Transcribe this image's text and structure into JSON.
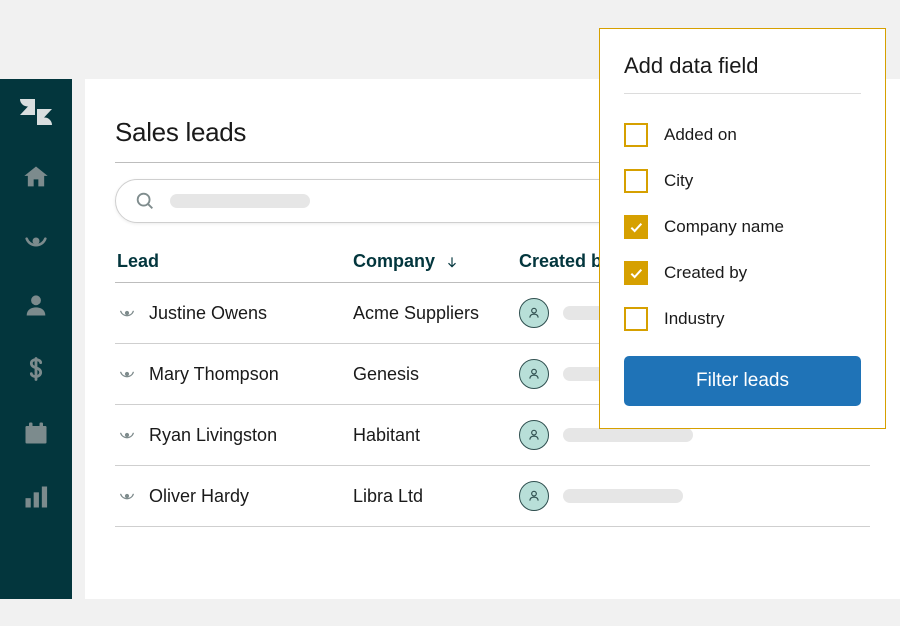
{
  "page": {
    "title": "Sales leads"
  },
  "columns": {
    "lead": "Lead",
    "company": "Company",
    "created": "Created by"
  },
  "rows": [
    {
      "lead": "Justine Owens",
      "company": "Acme Suppliers",
      "ph_width": 60
    },
    {
      "lead": "Mary Thompson",
      "company": "Genesis",
      "ph_width": 60
    },
    {
      "lead": "Ryan Livingston",
      "company": "Habitant",
      "ph_width": 130
    },
    {
      "lead": "Oliver Hardy",
      "company": "Libra Ltd",
      "ph_width": 120
    }
  ],
  "popover": {
    "title": "Add data field",
    "options": [
      {
        "label": "Added on",
        "checked": false
      },
      {
        "label": "City",
        "checked": false
      },
      {
        "label": "Company name",
        "checked": true
      },
      {
        "label": "Created by",
        "checked": true
      },
      {
        "label": "Industry",
        "checked": false
      }
    ],
    "button": "Filter leads"
  }
}
